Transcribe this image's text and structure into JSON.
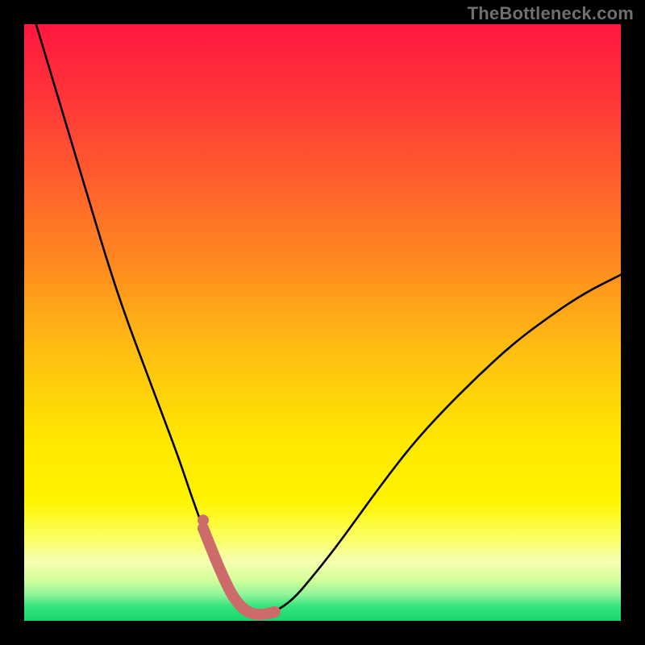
{
  "watermark": {
    "text": "TheBottleneck.com"
  },
  "colors": {
    "frame_bg": "#000000",
    "watermark": "#6f6f6f",
    "curve": "#000000",
    "marker": "#cd6a6a",
    "gradient_stops": [
      {
        "offset": 0.0,
        "color": "#ff173f"
      },
      {
        "offset": 0.1,
        "color": "#ff2f3a"
      },
      {
        "offset": 0.25,
        "color": "#ff5b2e"
      },
      {
        "offset": 0.4,
        "color": "#ff8a1f"
      },
      {
        "offset": 0.55,
        "color": "#ffbf12"
      },
      {
        "offset": 0.7,
        "color": "#ffe800"
      },
      {
        "offset": 0.8,
        "color": "#fff400"
      },
      {
        "offset": 0.86,
        "color": "#fbff62"
      },
      {
        "offset": 0.9,
        "color": "#f6ffb0"
      },
      {
        "offset": 0.93,
        "color": "#d7ff9a"
      },
      {
        "offset": 0.955,
        "color": "#93f59a"
      },
      {
        "offset": 0.975,
        "color": "#37e47e"
      },
      {
        "offset": 1.0,
        "color": "#18d66c"
      }
    ]
  },
  "chart_data": {
    "type": "line",
    "title": "",
    "xlabel": "",
    "ylabel": "",
    "xlim": [
      0,
      100
    ],
    "ylim": [
      0,
      100
    ],
    "legend": false,
    "grid": false,
    "series": [
      {
        "name": "bottleneck-curve",
        "x": [
          2,
          5,
          8,
          11,
          14,
          17,
          20,
          23,
          26,
          28,
          30,
          32,
          33.5,
          35,
          36.5,
          38,
          40,
          42,
          45,
          48,
          52,
          56,
          60,
          65,
          70,
          76,
          82,
          88,
          94,
          100
        ],
        "y": [
          100,
          90,
          80,
          70,
          60,
          51,
          43,
          35,
          27,
          21,
          15.5,
          10.5,
          7,
          4,
          2.2,
          1.2,
          1.0,
          1.5,
          3.5,
          7,
          12,
          17.5,
          23,
          29.5,
          35,
          41,
          46.5,
          51,
          55,
          58
        ]
      }
    ],
    "markers": {
      "name": "highlight-segment",
      "x": [
        30,
        32,
        33.5,
        35,
        36.5,
        38,
        40,
        42
      ],
      "y": [
        15.5,
        10.5,
        7,
        4,
        2.2,
        1.2,
        1.0,
        1.5
      ],
      "color_ref": "marker"
    },
    "background": {
      "kind": "vertical-gradient",
      "stops_ref": "gradient_stops"
    }
  }
}
